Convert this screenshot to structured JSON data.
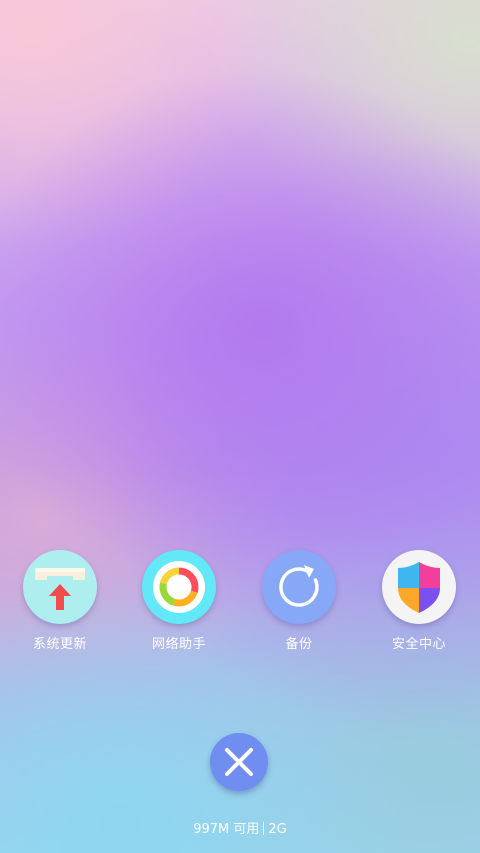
{
  "actions": [
    {
      "id": "system-update",
      "label": "系统更新",
      "icon": "system-update-icon"
    },
    {
      "id": "network-assistant",
      "label": "网络助手",
      "icon": "network-assistant-icon"
    },
    {
      "id": "backup",
      "label": "备份",
      "icon": "backup-icon"
    },
    {
      "id": "security-center",
      "label": "安全中心",
      "icon": "security-shield-icon"
    }
  ],
  "close": {
    "icon": "close-icon"
  },
  "memory": {
    "available": "997M 可用",
    "total": "2G"
  },
  "colors": {
    "close_button": "#6f8ef0",
    "update_bg": "#aeeeee",
    "network_bg": "#62e8f6",
    "backup_bg": "#86a8f6",
    "security_bg": "#f4f4f4"
  }
}
